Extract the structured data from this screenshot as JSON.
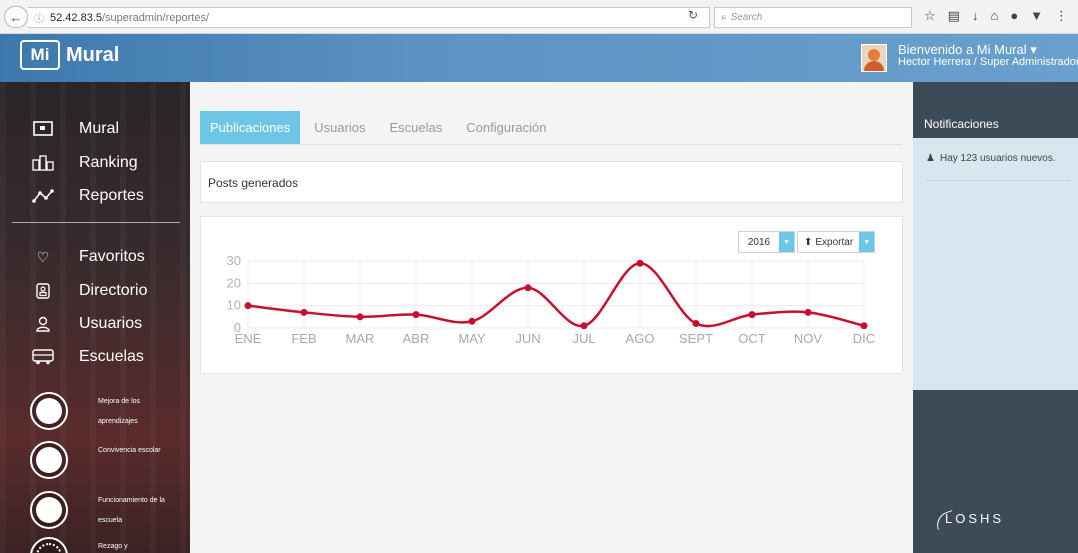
{
  "browser": {
    "url_host": "52.42.83.5",
    "url_path": "/superadmin/reportes/",
    "search_placeholder": "Search"
  },
  "header": {
    "logo_badge": "Mi",
    "logo_text": "Mural",
    "welcome": "Bienvenido a Mi Mural ▾",
    "user": "Hector Herrera / Super Administrador"
  },
  "sidebar": {
    "items": [
      {
        "label": "Mural",
        "icon": "monitor-icon"
      },
      {
        "label": "Ranking",
        "icon": "ranking-icon"
      },
      {
        "label": "Reportes",
        "icon": "line-chart-icon"
      },
      {
        "label": "Favoritos",
        "icon": "heart-icon"
      },
      {
        "label": "Directorio",
        "icon": "address-book-icon"
      },
      {
        "label": "Usuarios",
        "icon": "user-icon"
      },
      {
        "label": "Escuelas",
        "icon": "bus-icon"
      }
    ],
    "categories": [
      {
        "label": "Mejora de los aprendizajes"
      },
      {
        "label": "Convivencia escolar"
      },
      {
        "label": "Funcionamiento de la escuela"
      },
      {
        "label": "Rezago y"
      }
    ]
  },
  "main": {
    "tabs": [
      {
        "label": "Publicaciones",
        "active": true
      },
      {
        "label": "Usuarios",
        "active": false
      },
      {
        "label": "Escuelas",
        "active": false
      },
      {
        "label": "Configuración",
        "active": false
      }
    ],
    "panel_title": "Posts generados",
    "year": "2016",
    "export_label": "Exportar"
  },
  "notifications": {
    "title": "Notificaciones",
    "items": [
      {
        "text": "Hay 123 usuarios nuevos."
      }
    ]
  },
  "footer_brand": "LOSHS",
  "colors": {
    "accent": "#6ec6e6",
    "line": "#c8102e",
    "header": "#4a86bb"
  },
  "chart_data": {
    "type": "line",
    "categories": [
      "ENE",
      "FEB",
      "MAR",
      "ABR",
      "MAY",
      "JUN",
      "JUL",
      "AGO",
      "SEPT",
      "OCT",
      "NOV",
      "DIC"
    ],
    "values": [
      10,
      7,
      5,
      6,
      3,
      18,
      1,
      29,
      2,
      6,
      7,
      1
    ],
    "ylim": [
      0,
      30
    ],
    "yticks": [
      0,
      10,
      20,
      30
    ],
    "grid": true,
    "xlabel": "",
    "ylabel": ""
  }
}
